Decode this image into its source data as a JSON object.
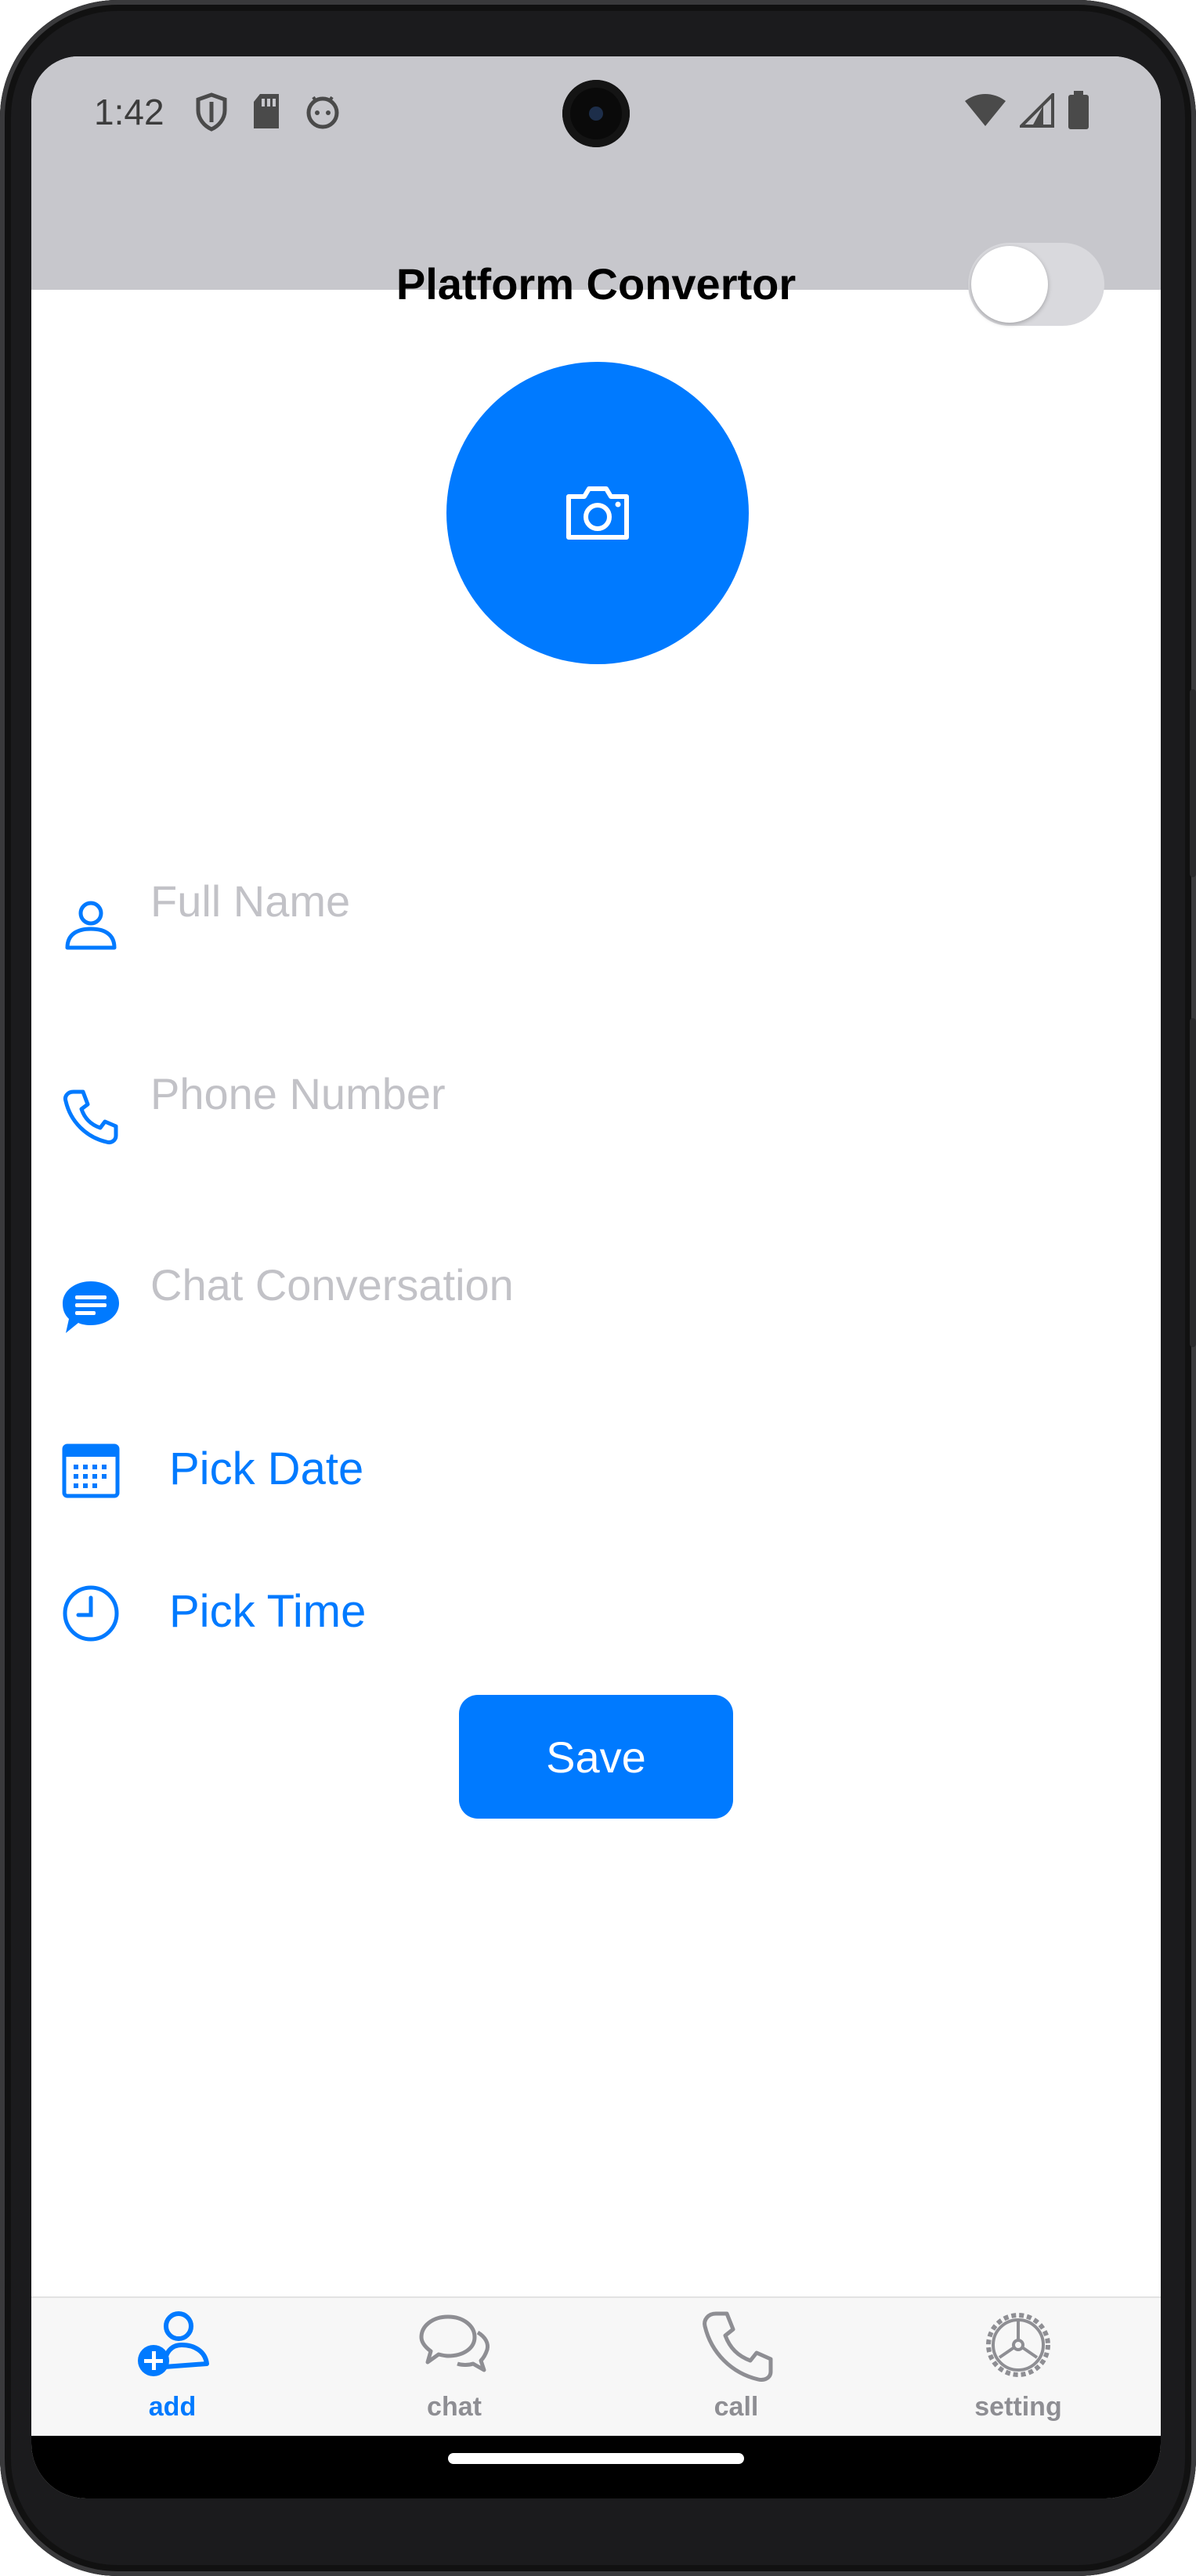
{
  "status": {
    "time": "1:42",
    "left_icons": [
      "shield-icon",
      "sd-card-icon",
      "android-face-icon"
    ],
    "right_icons": [
      "wifi-icon",
      "signal-icon",
      "battery-icon"
    ]
  },
  "appbar": {
    "title": "Platform Convertor",
    "toggle_on": false
  },
  "avatar": {
    "icon": "camera-icon",
    "color": "#007aff"
  },
  "form": {
    "full_name": {
      "placeholder": "Full Name",
      "value": "",
      "icon": "person-icon"
    },
    "phone": {
      "placeholder": "Phone Number",
      "value": "",
      "icon": "phone-icon"
    },
    "chat": {
      "placeholder": "Chat Conversation",
      "value": "",
      "icon": "chat-bubble-icon"
    },
    "pick_date": {
      "label": "Pick Date",
      "icon": "calendar-icon"
    },
    "pick_time": {
      "label": "Pick Time",
      "icon": "clock-icon"
    },
    "save_label": "Save"
  },
  "tabs": [
    {
      "label": "add",
      "icon": "add-person-icon",
      "active": true
    },
    {
      "label": "chat",
      "icon": "chat-icon",
      "active": false
    },
    {
      "label": "call",
      "icon": "phone-icon",
      "active": false
    },
    {
      "label": "setting",
      "icon": "gear-icon",
      "active": false
    }
  ],
  "colors": {
    "accent": "#007aff",
    "bar_background": "#c7c7cc",
    "placeholder": "#c2c2c7",
    "inactive_tab": "#8e8e93"
  }
}
